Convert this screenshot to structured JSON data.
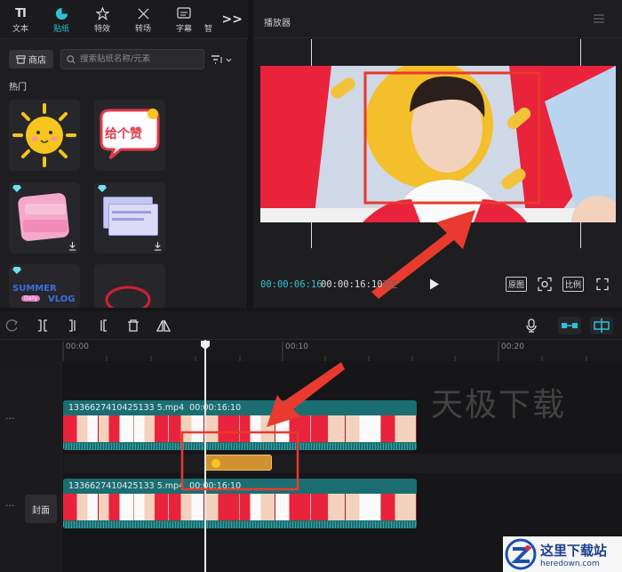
{
  "categories": [
    {
      "label": "文本",
      "icon": "text-icon"
    },
    {
      "label": "贴纸",
      "icon": "sticker-icon",
      "active": true
    },
    {
      "label": "特效",
      "icon": "effects-icon"
    },
    {
      "label": "转场",
      "icon": "transition-icon"
    },
    {
      "label": "字幕",
      "icon": "subtitle-icon"
    },
    {
      "label": "智",
      "icon": "smart-icon"
    }
  ],
  "more_label": ">>",
  "shop_label": "商店",
  "search": {
    "placeholder": "搜索贴纸名称/元素"
  },
  "section_title": "热门",
  "sticker_texts": {
    "s2": "给个赞",
    "s5": "SUMMER",
    "s5b": "VLOG",
    "s5c": "Daily"
  },
  "player": {
    "title": "播放器",
    "current_time": "00:00:06:16",
    "total_time": "00:00:16:10",
    "btn_original": "原图",
    "btn_ratio": "比例"
  },
  "ruler": {
    "labels": [
      "00:00",
      "00:10",
      "00:20"
    ]
  },
  "clips": [
    {
      "label": "1336627410425133 5.mp4",
      "duration": "00:00:16:10"
    },
    {
      "label": "1336627410425133 5.mp4",
      "duration": "00:00:16:10"
    }
  ],
  "cover_label": "封面",
  "watermark": "天极下载",
  "logo": {
    "title": "这里下载站",
    "url": "heredown.com"
  },
  "colors": {
    "accent": "#2ec0d8",
    "sticker_clip": "#d09230",
    "clip": "#1a6e72",
    "highlight_red": "#e83a2e"
  }
}
